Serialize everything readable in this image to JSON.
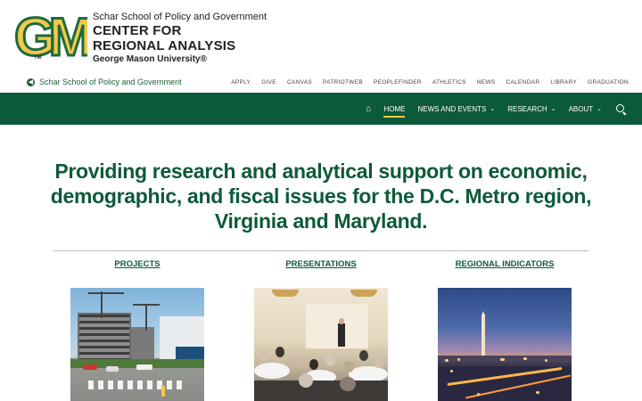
{
  "header": {
    "logo_letters": "GM",
    "logo_tm": "TM",
    "school": "Schar School of Policy and Government",
    "center_line1": "CENTER FOR",
    "center_line2": "REGIONAL ANALYSIS",
    "university": "George Mason University®"
  },
  "utility": {
    "back_link": "Schar School of Policy and Government",
    "links": [
      "APPLY",
      "GIVE",
      "CANVAS",
      "PATRIOTWEB",
      "PEOPLEFINDER",
      "ATHLETICS",
      "NEWS",
      "CALENDAR",
      "LIBRARY",
      "GRADUATION"
    ]
  },
  "nav": {
    "home_icon": "home-icon",
    "items": [
      {
        "label": "HOME",
        "active": true,
        "dropdown": false
      },
      {
        "label": "NEWS AND EVENTS",
        "active": false,
        "dropdown": true
      },
      {
        "label": "RESEARCH",
        "active": false,
        "dropdown": true
      },
      {
        "label": "ABOUT",
        "active": false,
        "dropdown": true
      }
    ],
    "search_icon": "search-icon"
  },
  "hero": {
    "headline": "Providing research and analytical support on economic, demographic, and fiscal issues for the D.C. Metro region, Virginia and Maryland."
  },
  "sections": [
    {
      "title": "PROJECTS"
    },
    {
      "title": "PRESENTATIONS"
    },
    {
      "title": "REGIONAL INDICATORS"
    }
  ],
  "colors": {
    "brand_green": "#0d5a3a",
    "brand_gold": "#f2c94c",
    "logo_green": "#1e6b3a"
  }
}
